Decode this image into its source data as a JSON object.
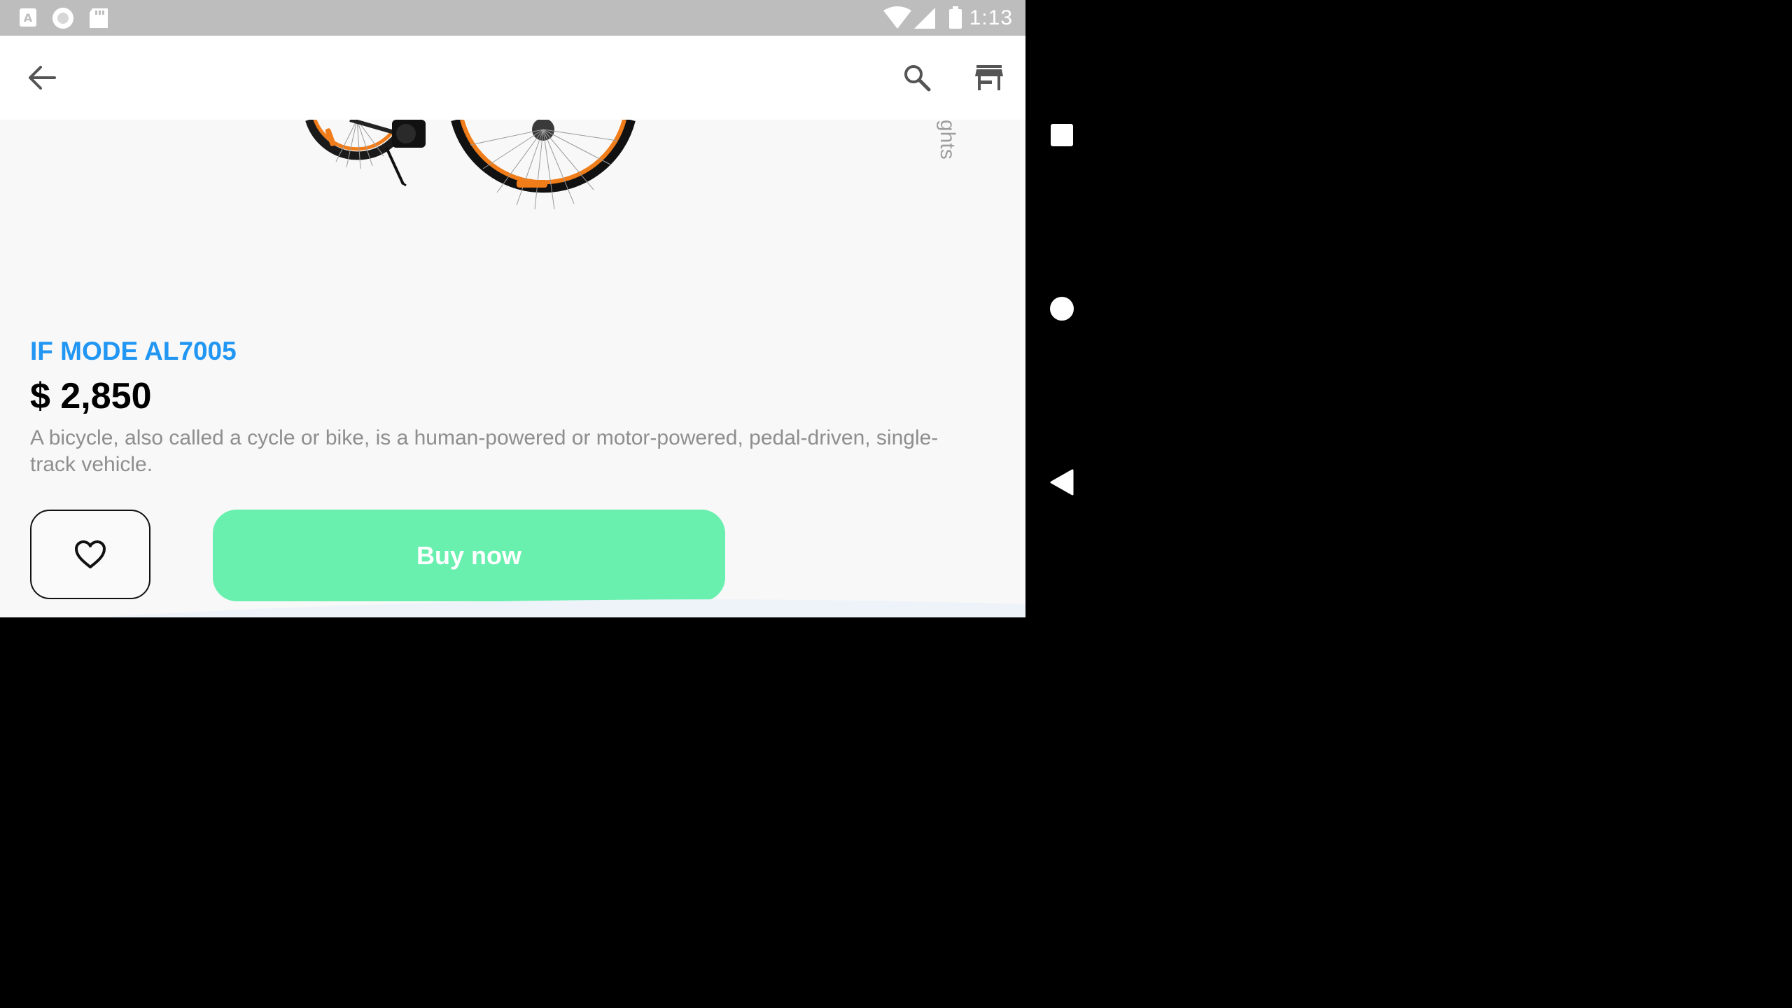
{
  "status_bar": {
    "time": "1:13",
    "left_icons": [
      "text-a-icon",
      "record-circle-icon",
      "sd-card-icon"
    ],
    "right_icons": [
      "wifi-icon",
      "signal-icon",
      "battery-icon"
    ]
  },
  "app_bar": {
    "icons": [
      "back-arrow-icon",
      "search-icon",
      "store-icon"
    ]
  },
  "product": {
    "side_label": "ghts",
    "name": "IF MODE AL7005",
    "price": "$ 2,850",
    "description": "A bicycle, also called a cycle or bike, is a human-powered or motor-powered, pedal-driven, single-track vehicle."
  },
  "actions": {
    "favorite_icon": "heart-outline-icon",
    "buy_label": "Buy now"
  },
  "nav_bar": {
    "icons": [
      "recents-square-icon",
      "home-circle-icon",
      "back-triangle-icon"
    ]
  },
  "colors": {
    "status_bar": "#bdbdbd",
    "product_name": "#2196f3",
    "buy_button": "#69f0ae",
    "bike_accent": "#f07d1a"
  }
}
